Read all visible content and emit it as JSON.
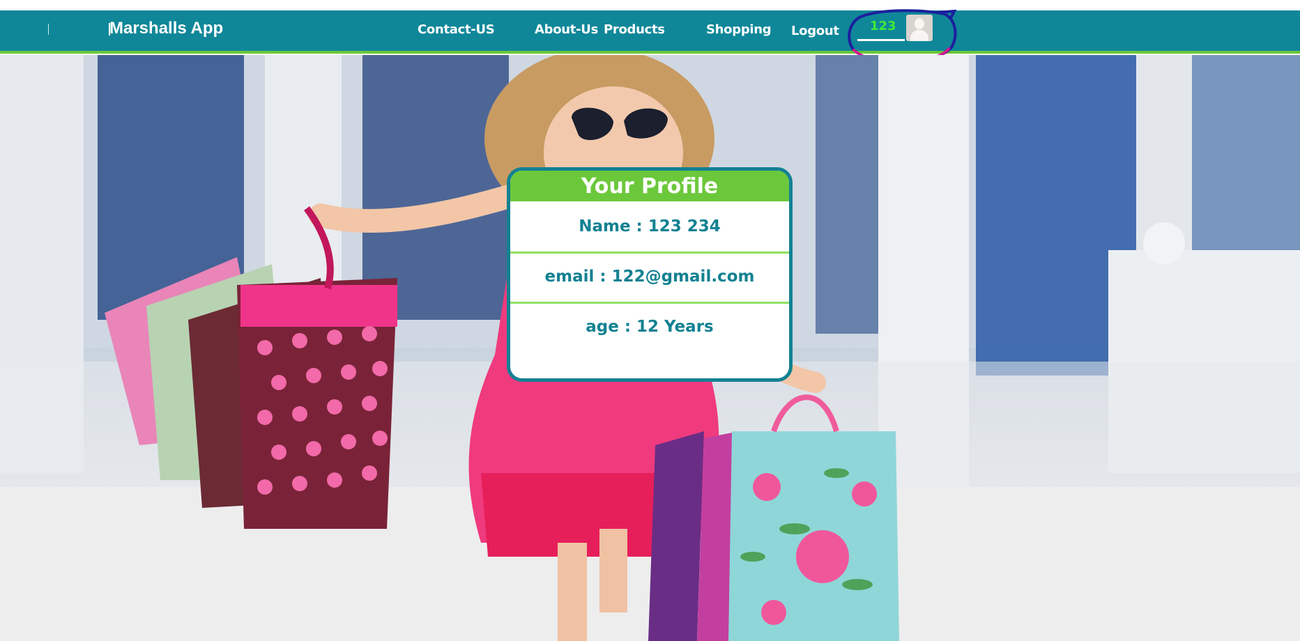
{
  "navbar": {
    "brand": "Marshalls App",
    "links": {
      "contact": "Contact-US",
      "about": "About-Us",
      "products": "Products",
      "shopping": "Shopping",
      "logout": "Logout"
    },
    "user": {
      "name": "123",
      "avatar_icon": "user-avatar-icon"
    },
    "colors": {
      "bar": "#0f8799",
      "accent": "#6cc83b",
      "username": "#3dea3a"
    }
  },
  "profile": {
    "title": "Your Profile",
    "name_line": "Name : 123 234",
    "email_line": "email : 122@gmail.com",
    "age_line": "age : 12 Years"
  },
  "hero": {
    "image": "girl-with-shopping-bags-photo"
  }
}
